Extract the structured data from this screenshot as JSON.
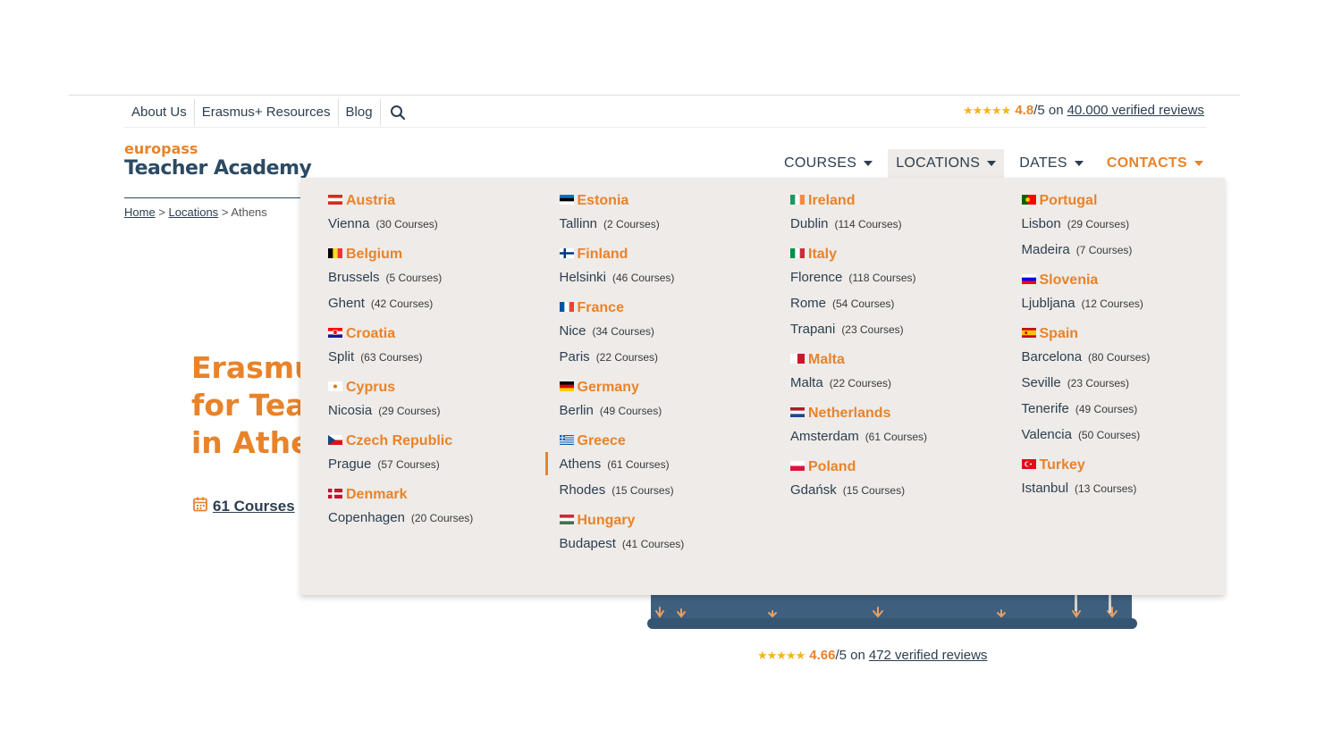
{
  "topbar": {
    "links": [
      "About Us",
      "Erasmus+ Resources",
      "Blog"
    ],
    "search_icon": "search-icon",
    "rating": {
      "stars": "★★★★★",
      "score": "4.8",
      "suffix": "/5 on",
      "link": "40.000 verified reviews"
    }
  },
  "logo": {
    "line1": "europass",
    "line2": "Teacher Academy"
  },
  "breadcrumb": {
    "home": "Home",
    "sep1": ">",
    "locations": "Locations",
    "sep2": ">",
    "current": "Athens"
  },
  "nav": {
    "courses": "COURSES",
    "locations": "LOCATIONS",
    "dates": "DATES",
    "contacts": "CONTACTS"
  },
  "hero": {
    "line1": "Erasmus+",
    "line2": "for Teachers",
    "line3": "in Athens",
    "courses_link": "61 Courses",
    "calendar_icon": "calendar-icon"
  },
  "bottom_rating": {
    "stars": "★★★★★",
    "score": "4.66",
    "suffix": "/5 on",
    "link": "472 verified reviews"
  },
  "colors": {
    "accent": "#e8832a",
    "navy": "#2c3e50",
    "dropdown_bg": "#eeebe8"
  },
  "dropdown": {
    "columns": [
      [
        {
          "country": "Austria",
          "flag": "austria-flag-icon",
          "cities": [
            {
              "name": "Vienna",
              "count": "(30 Courses)"
            }
          ]
        },
        {
          "country": "Belgium",
          "flag": "belgium-flag-icon",
          "cities": [
            {
              "name": "Brussels",
              "count": "(5 Courses)"
            },
            {
              "name": "Ghent",
              "count": "(42 Courses)"
            }
          ]
        },
        {
          "country": "Croatia",
          "flag": "croatia-flag-icon",
          "cities": [
            {
              "name": "Split",
              "count": "(63 Courses)"
            }
          ]
        },
        {
          "country": "Cyprus",
          "flag": "cyprus-flag-icon",
          "cities": [
            {
              "name": "Nicosia",
              "count": "(29 Courses)"
            }
          ]
        },
        {
          "country": "Czech Republic",
          "flag": "czech-flag-icon",
          "cities": [
            {
              "name": "Prague",
              "count": "(57 Courses)"
            }
          ]
        },
        {
          "country": "Denmark",
          "flag": "denmark-flag-icon",
          "cities": [
            {
              "name": "Copenhagen",
              "count": "(20 Courses)"
            }
          ]
        }
      ],
      [
        {
          "country": "Estonia",
          "flag": "estonia-flag-icon",
          "cities": [
            {
              "name": "Tallinn",
              "count": "(2 Courses)"
            }
          ]
        },
        {
          "country": "Finland",
          "flag": "finland-flag-icon",
          "cities": [
            {
              "name": "Helsinki",
              "count": "(46 Courses)"
            }
          ]
        },
        {
          "country": "France",
          "flag": "france-flag-icon",
          "cities": [
            {
              "name": "Nice",
              "count": "(34 Courses)"
            },
            {
              "name": "Paris",
              "count": "(22 Courses)"
            }
          ]
        },
        {
          "country": "Germany",
          "flag": "germany-flag-icon",
          "cities": [
            {
              "name": "Berlin",
              "count": "(49 Courses)"
            }
          ]
        },
        {
          "country": "Greece",
          "flag": "greece-flag-icon",
          "cities": [
            {
              "name": "Athens",
              "count": "(61 Courses)",
              "current": true
            },
            {
              "name": "Rhodes",
              "count": "(15 Courses)"
            }
          ]
        },
        {
          "country": "Hungary",
          "flag": "hungary-flag-icon",
          "cities": [
            {
              "name": "Budapest",
              "count": "(41 Courses)"
            }
          ]
        }
      ],
      [
        {
          "country": "Ireland",
          "flag": "ireland-flag-icon",
          "cities": [
            {
              "name": "Dublin",
              "count": "(114 Courses)"
            }
          ]
        },
        {
          "country": "Italy",
          "flag": "italy-flag-icon",
          "cities": [
            {
              "name": "Florence",
              "count": "(118 Courses)"
            },
            {
              "name": "Rome",
              "count": "(54 Courses)"
            },
            {
              "name": "Trapani",
              "count": "(23 Courses)"
            }
          ]
        },
        {
          "country": "Malta",
          "flag": "malta-flag-icon",
          "cities": [
            {
              "name": "Malta",
              "count": "(22 Courses)"
            }
          ]
        },
        {
          "country": "Netherlands",
          "flag": "netherlands-flag-icon",
          "cities": [
            {
              "name": "Amsterdam",
              "count": "(61 Courses)"
            }
          ]
        },
        {
          "country": "Poland",
          "flag": "poland-flag-icon",
          "cities": [
            {
              "name": "Gdańsk",
              "count": "(15 Courses)"
            }
          ]
        }
      ],
      [
        {
          "country": "Portugal",
          "flag": "portugal-flag-icon",
          "cities": [
            {
              "name": "Lisbon",
              "count": "(29 Courses)"
            },
            {
              "name": "Madeira",
              "count": "(7 Courses)"
            }
          ]
        },
        {
          "country": "Slovenia",
          "flag": "slovenia-flag-icon",
          "cities": [
            {
              "name": "Ljubljana",
              "count": "(12 Courses)"
            }
          ]
        },
        {
          "country": "Spain",
          "flag": "spain-flag-icon",
          "cities": [
            {
              "name": "Barcelona",
              "count": "(80 Courses)"
            },
            {
              "name": "Seville",
              "count": "(23 Courses)"
            },
            {
              "name": "Tenerife",
              "count": "(49 Courses)"
            },
            {
              "name": "Valencia",
              "count": "(50 Courses)"
            }
          ]
        },
        {
          "country": "Turkey",
          "flag": "turkey-flag-icon",
          "cities": [
            {
              "name": "Istanbul",
              "count": "(13 Courses)"
            }
          ]
        }
      ]
    ]
  }
}
